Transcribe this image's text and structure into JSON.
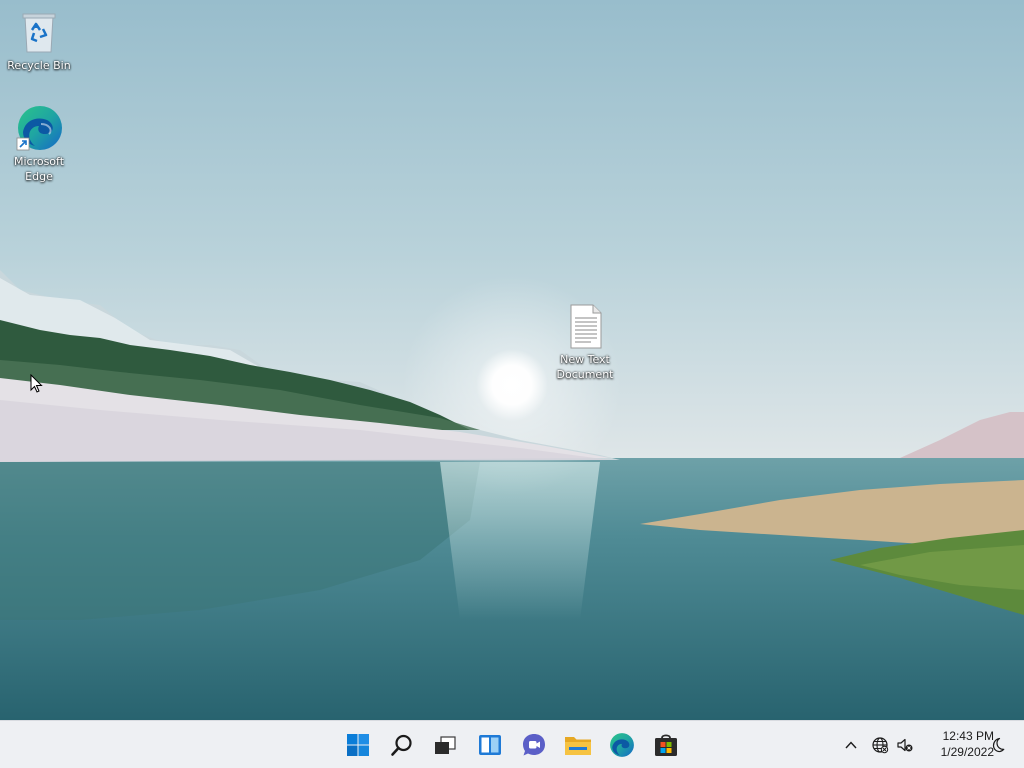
{
  "desktop": {
    "icons": [
      {
        "label": "Recycle Bin",
        "icon": "recycle-bin-icon"
      },
      {
        "label": "Microsoft Edge",
        "icon": "edge-icon"
      },
      {
        "label": "New Text Document",
        "icon": "text-document-icon"
      }
    ]
  },
  "taskbar": {
    "apps": [
      {
        "name": "Start",
        "icon": "windows-start-icon"
      },
      {
        "name": "Search",
        "icon": "search-icon"
      },
      {
        "name": "Task View",
        "icon": "task-view-icon"
      },
      {
        "name": "Widgets",
        "icon": "widgets-icon"
      },
      {
        "name": "Chat",
        "icon": "chat-icon"
      },
      {
        "name": "File Explorer",
        "icon": "folder-icon"
      },
      {
        "name": "Microsoft Edge",
        "icon": "edge-icon"
      },
      {
        "name": "Microsoft Store",
        "icon": "store-icon"
      }
    ],
    "tray": {
      "icons": [
        "chevron-up-icon",
        "network-globe-icon",
        "speaker-muted-icon"
      ],
      "time": "12:43 PM",
      "date": "1/29/2022",
      "notification_icon": "moon-icon"
    }
  },
  "colors": {
    "taskbar_bg": "#eef0f3",
    "windows_blue": "#0078d4",
    "edge_teal": "#1fa5a2",
    "folder_yellow": "#f6c342",
    "chat_purple": "#5b5fc7"
  }
}
